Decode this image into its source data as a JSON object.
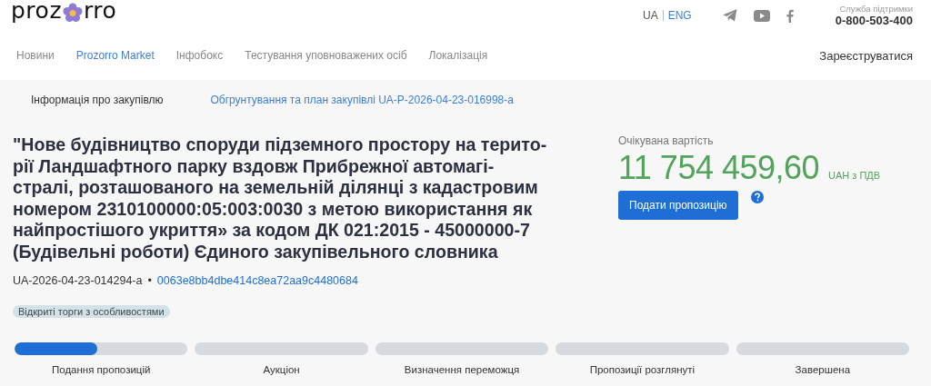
{
  "header": {
    "logo": {
      "left": "proz",
      "right": "rro"
    },
    "languages": [
      {
        "label": "UA",
        "selected": true
      },
      {
        "label": "ENG",
        "selected": false
      }
    ],
    "support": {
      "label": "Служба підтримки",
      "phone": "0-800-503-400"
    }
  },
  "nav": {
    "items": [
      {
        "label": "Новини",
        "selected": false
      },
      {
        "label": "Prozorro Market",
        "selected": true
      },
      {
        "label": "Інфобокс",
        "selected": false
      },
      {
        "label": "Тестування уповноважених осіб",
        "selected": false
      },
      {
        "label": "Локалізація",
        "selected": false
      }
    ],
    "register": "Зареєструватися"
  },
  "tabs": [
    {
      "label": "Інформація про закупівлю",
      "selected": true
    },
    {
      "label": "Обгрунтування та план закупівлі UA-P-2026-04-23-016998-a",
      "selected": false
    }
  ],
  "tender": {
    "title": "\"Нове будівництво споруди підземного простору на терито-рії Ландшафтного парку вздовж Прибрежної автомагі-стралі, розташованого на земельній ділянці з кадастровим номером 2310100000:05:003:0030 з метою використання як найпростішого укриття» за кодом ДК 021:2015 - 45000000-7 (Будівельні роботи) Єдиного закупівельного словника",
    "id": "UA-2026-04-23-014294-a",
    "separator": "•",
    "hash": "0063e8bb4dbe414c8ea72aa9c4480684",
    "procedure": "Відкриті торги з особливостями"
  },
  "price": {
    "label": "Очікувана вартість",
    "amount": "11 754 459,60",
    "currency": "UAH з ПДВ",
    "button": "Подати пропозицію"
  },
  "stages": [
    {
      "label": "Подання пропозицій",
      "level": 0.48
    },
    {
      "label": "Аукціон"
    },
    {
      "label": "Визначення переможця"
    },
    {
      "label": "Пропозиції розглянуті"
    },
    {
      "label": "Завершена"
    }
  ]
}
